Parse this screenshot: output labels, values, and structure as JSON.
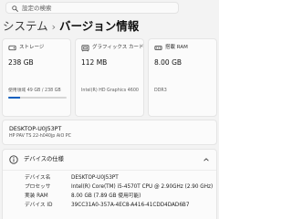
{
  "search": {
    "placeholder": "設定の検索"
  },
  "header": {
    "root": "システム",
    "separator": "›",
    "page": "バージョン情報"
  },
  "cards": [
    {
      "icon": "storage-icon",
      "label": "ストレージ",
      "value": "238 GB",
      "sub": "使用領域 49 GB / 238 GB",
      "usage_fraction": 0.206
    },
    {
      "icon": "graphics-card-icon",
      "label": "グラフィックス カード",
      "value": "112 MB",
      "sub": "Intel(R) HD Graphics 4600"
    },
    {
      "icon": "ram-icon",
      "label": "搭載 RAM",
      "value": "8.00 GB",
      "sub": "DDR3"
    }
  ],
  "device": {
    "name": "DESKTOP-U0J53PT",
    "model": "HP PAV TS 22-h040jp AiO PC"
  },
  "specs": {
    "title": "デバイスの仕様",
    "rows": [
      {
        "key": "デバイス名",
        "value": "DESKTOP-U0J53PT"
      },
      {
        "key": "プロセッサ",
        "value": "Intel(R) Core(TM) i5-4570T CPU @ 2.90GHz (2.90 GHz)"
      },
      {
        "key": "実装 RAM",
        "value": "8.00 GB (7.89 GB 使用可能)"
      },
      {
        "key": "デバイス ID",
        "value": "39CC31A0-357A-4EC8-A416-41CDD4DAD6B7"
      }
    ]
  },
  "colors": {
    "accent": "#0a5fbf",
    "background": "#f3f3f3",
    "card": "#fbfbfb"
  }
}
